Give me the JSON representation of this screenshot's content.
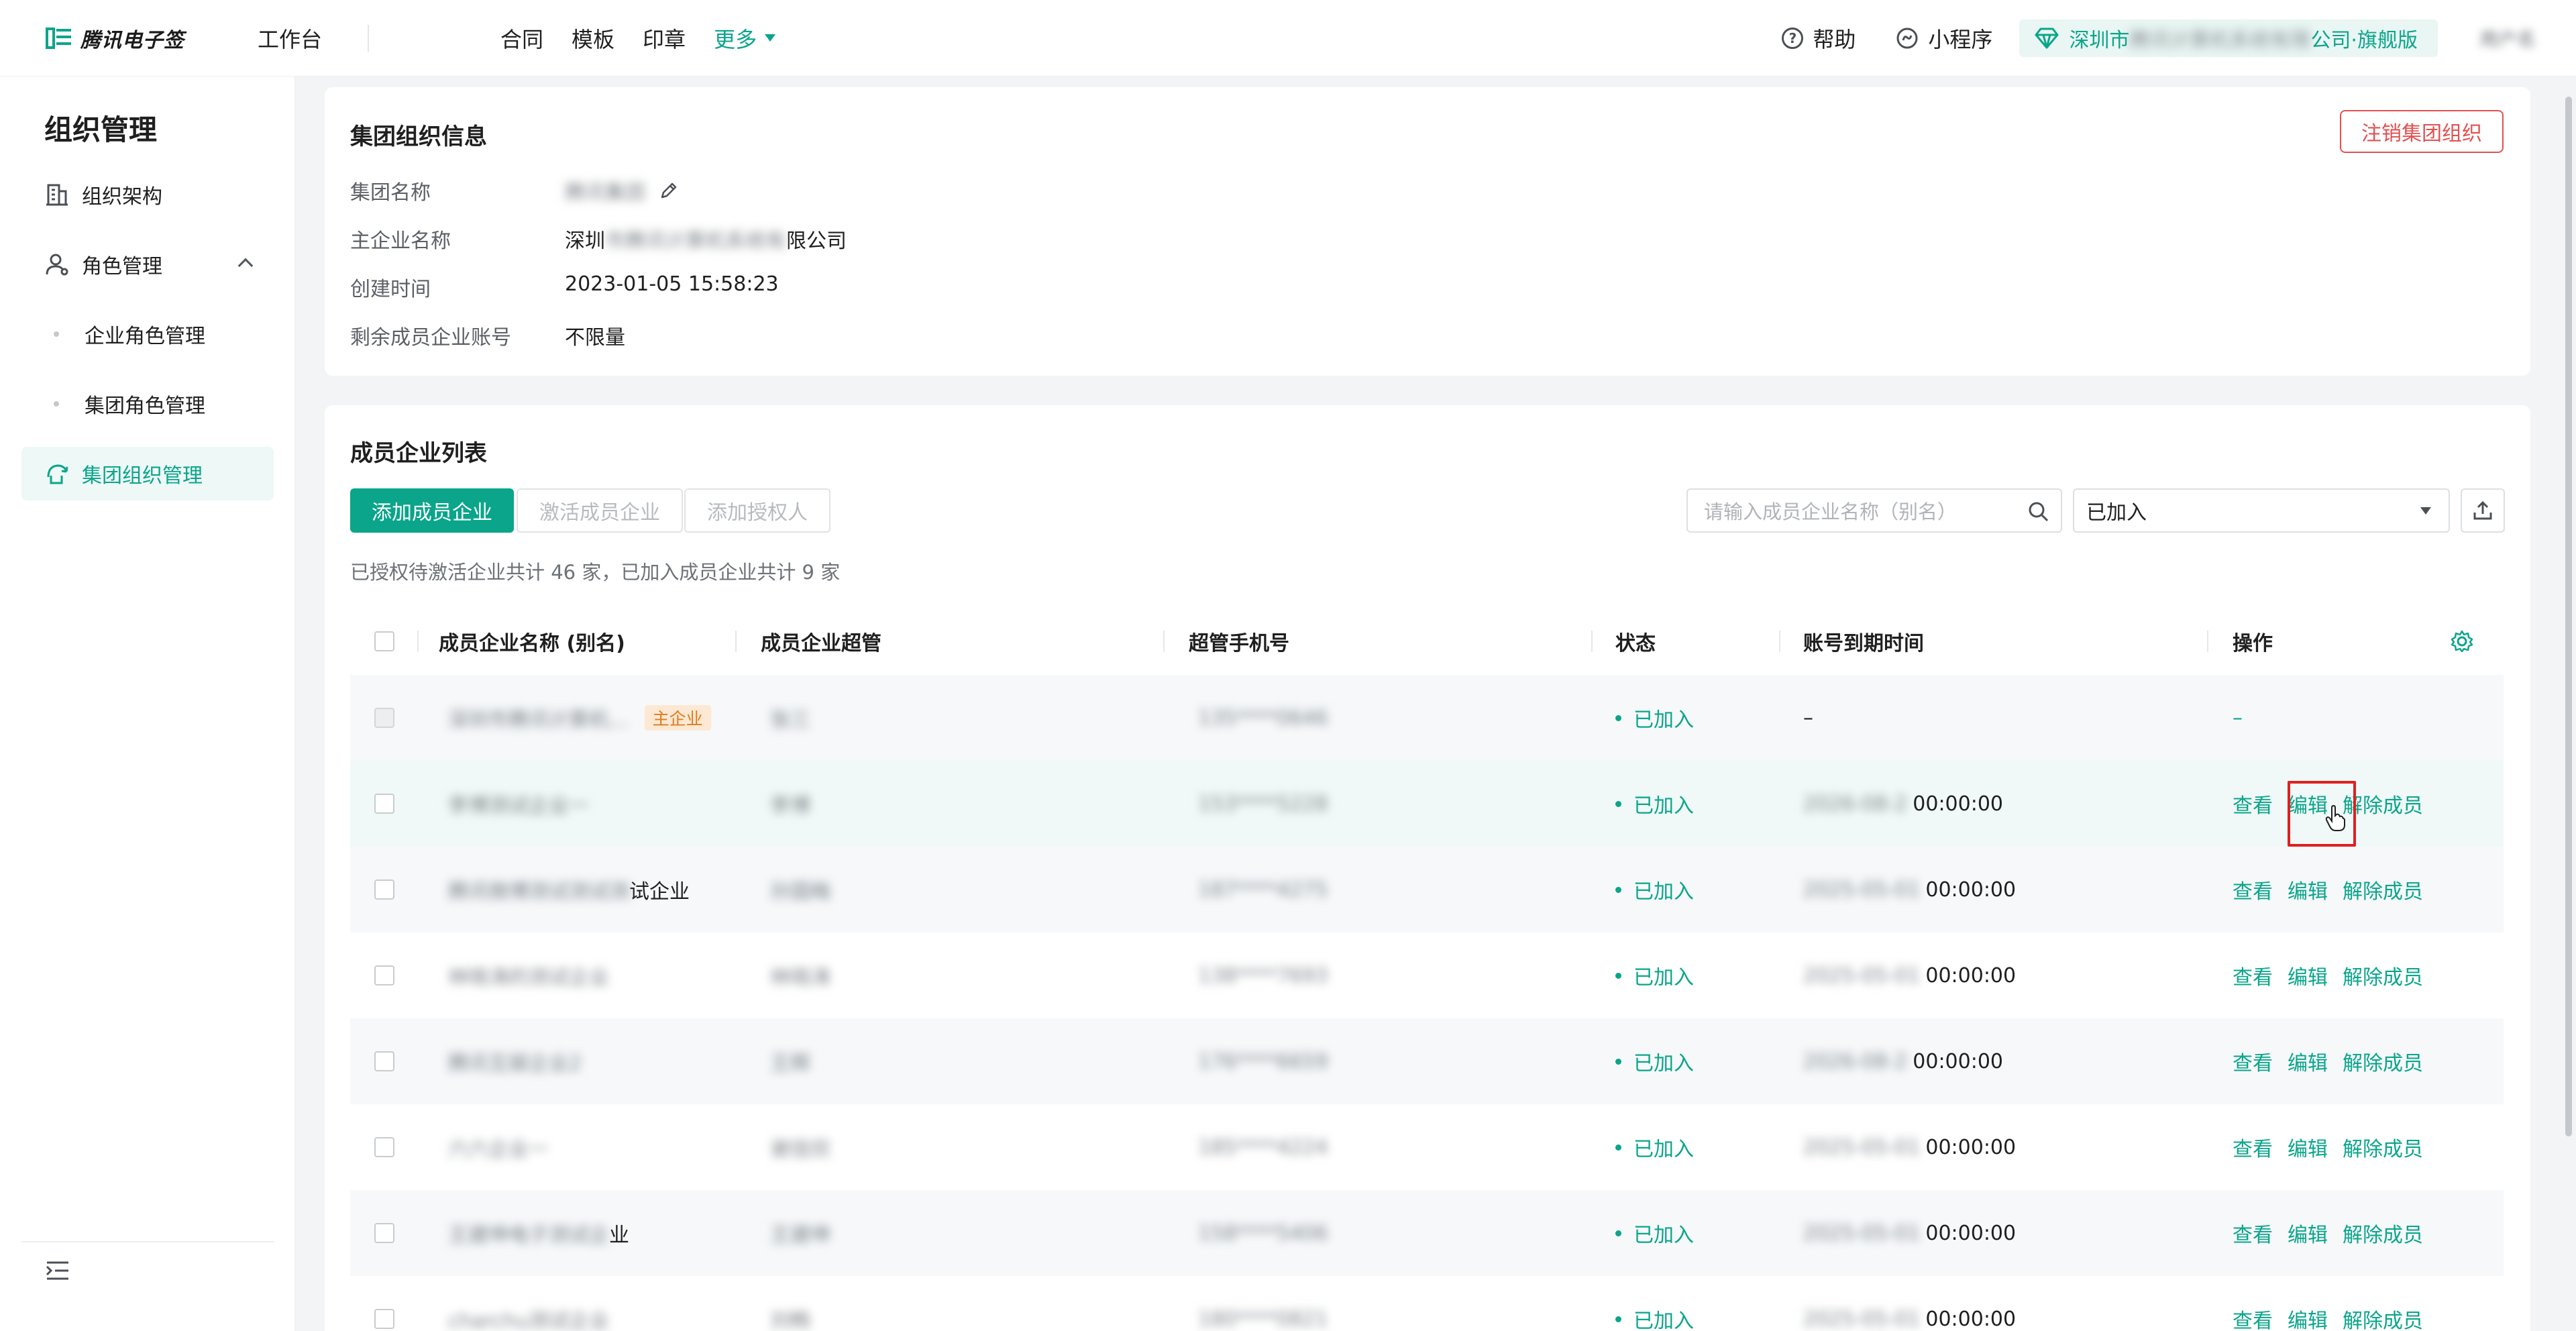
{
  "topbar": {
    "brand": "腾讯电子签",
    "workbench": "工作台",
    "nav": [
      "合同",
      "模板",
      "印章",
      "更多"
    ],
    "help": "帮助",
    "miniprogram": "小程序",
    "org_prefix": "深圳市",
    "org_hidden": "腾讯计算机系统有限",
    "org_suffix": "公司·旗舰版",
    "user": "用户名"
  },
  "sidebar": {
    "title": "组织管理",
    "items": [
      "组织架构",
      "角色管理",
      "企业角色管理",
      "集团角色管理",
      "集团组织管理"
    ]
  },
  "group_info": {
    "title": "集团组织信息",
    "cancel_button": "注销集团组织",
    "rows": [
      {
        "label": "集团名称",
        "value": "腾讯集团"
      },
      {
        "label": "主企业名称",
        "value_prefix": "深圳",
        "value_hidden": "市腾讯计算机系统有",
        "value_suffix": "限公司"
      },
      {
        "label": "创建时间",
        "value": "2023-01-05 15:58:23"
      },
      {
        "label": "剩余成员企业账号",
        "value": "不限量"
      }
    ]
  },
  "member_list": {
    "title": "成员企业列表",
    "add_button": "添加成员企业",
    "activate_button": "激活成员企业",
    "authorize_button": "添加授权人",
    "search_placeholder": "请输入成员企业名称（别名）",
    "filter_selected": "已加入",
    "summary": "已授权待激活企业共计 46 家，已加入成员企业共计 9 家",
    "columns": [
      "成员企业名称 (别名)",
      "成员企业超管",
      "超管手机号",
      "状态",
      "账号到期时间",
      "操作"
    ],
    "main_tag": "主企业",
    "actions": {
      "view": "查看",
      "edit": "编辑",
      "remove": "解除成员"
    },
    "rows": [
      {
        "name_hidden": "深圳市腾讯计算机...",
        "name_tail": "",
        "admin": "张三",
        "phone": "135****0646",
        "status": "已加入",
        "expire_hidden": "",
        "expire_tail": "–",
        "is_main": true
      },
      {
        "name_hidden": "李博测试企业一",
        "name_tail": "",
        "admin": "李博",
        "phone": "153****5228",
        "status": "已加入",
        "expire_hidden": "2026-08-2",
        "expire_tail": "00:00:00",
        "is_main": false
      },
      {
        "name_hidden": "腾讯微博测试测试测",
        "name_tail": "试企业",
        "admin": "孙国梅",
        "phone": "187****4275",
        "status": "已加入",
        "expire_hidden": "2025-05-01",
        "expire_tail": "00:00:00",
        "is_main": false
      },
      {
        "name_hidden": "林晓涛的测试企业",
        "name_tail": "",
        "admin": "林晓涛",
        "phone": "138****7693",
        "status": "已加入",
        "expire_hidden": "2025-05-01",
        "expire_tail": "00:00:00",
        "is_main": false
      },
      {
        "name_hidden": "腾讯互娱企业2",
        "name_tail": "",
        "admin": "王辉",
        "phone": "176****6659",
        "status": "已加入",
        "expire_hidden": "2026-08-2",
        "expire_tail": "00:00:00",
        "is_main": false
      },
      {
        "name_hidden": "六六企业一",
        "name_tail": "",
        "admin": "谢佳欣",
        "phone": "185****4224",
        "status": "已加入",
        "expire_hidden": "2025-05-01",
        "expire_tail": "00:00:00",
        "is_main": false
      },
      {
        "name_hidden": "王建坤电子测试企",
        "name_tail": "业",
        "admin": "王建坤",
        "phone": "158****5406",
        "status": "已加入",
        "expire_hidden": "2025-05-01",
        "expire_tail": "00:00:00",
        "is_main": false
      },
      {
        "name_hidden": "charchu测试企业",
        "name_tail": "",
        "admin": "刘畅",
        "phone": "180****0821",
        "status": "已加入",
        "expire_hidden": "2025-05-01",
        "expire_tail": "00:00:00",
        "is_main": false
      }
    ]
  },
  "colors": {
    "accent": "#0aa58a",
    "danger": "#e15151",
    "tag_bg": "#fde9d3",
    "tag_text": "#e07a1f"
  }
}
